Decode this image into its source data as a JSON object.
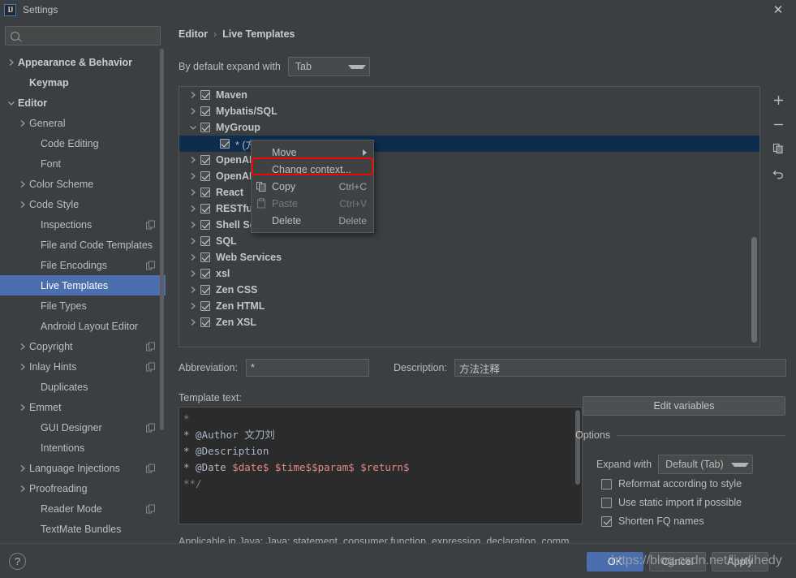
{
  "window": {
    "title": "Settings",
    "logo_text": "IJ",
    "close_label": "✕"
  },
  "sidebar": {
    "search_placeholder": "",
    "search_value": "",
    "items": [
      {
        "label": "Appearance & Behavior",
        "arrow": "right",
        "bold": true,
        "indent": 0,
        "badge": false,
        "selected": false
      },
      {
        "label": "Keymap",
        "arrow": "none",
        "bold": true,
        "indent": 1,
        "badge": false,
        "selected": false
      },
      {
        "label": "Editor",
        "arrow": "down",
        "bold": true,
        "indent": 0,
        "badge": false,
        "selected": false
      },
      {
        "label": "General",
        "arrow": "right",
        "bold": false,
        "indent": 1,
        "badge": false,
        "selected": false
      },
      {
        "label": "Code Editing",
        "arrow": "none",
        "bold": false,
        "indent": 2,
        "badge": false,
        "selected": false
      },
      {
        "label": "Font",
        "arrow": "none",
        "bold": false,
        "indent": 2,
        "badge": false,
        "selected": false
      },
      {
        "label": "Color Scheme",
        "arrow": "right",
        "bold": false,
        "indent": 1,
        "badge": false,
        "selected": false
      },
      {
        "label": "Code Style",
        "arrow": "right",
        "bold": false,
        "indent": 1,
        "badge": false,
        "selected": false
      },
      {
        "label": "Inspections",
        "arrow": "none",
        "bold": false,
        "indent": 2,
        "badge": true,
        "selected": false
      },
      {
        "label": "File and Code Templates",
        "arrow": "none",
        "bold": false,
        "indent": 2,
        "badge": false,
        "selected": false
      },
      {
        "label": "File Encodings",
        "arrow": "none",
        "bold": false,
        "indent": 2,
        "badge": true,
        "selected": false
      },
      {
        "label": "Live Templates",
        "arrow": "none",
        "bold": false,
        "indent": 2,
        "badge": false,
        "selected": true
      },
      {
        "label": "File Types",
        "arrow": "none",
        "bold": false,
        "indent": 2,
        "badge": false,
        "selected": false
      },
      {
        "label": "Android Layout Editor",
        "arrow": "none",
        "bold": false,
        "indent": 2,
        "badge": false,
        "selected": false
      },
      {
        "label": "Copyright",
        "arrow": "right",
        "bold": false,
        "indent": 1,
        "badge": true,
        "selected": false
      },
      {
        "label": "Inlay Hints",
        "arrow": "right",
        "bold": false,
        "indent": 1,
        "badge": true,
        "selected": false
      },
      {
        "label": "Duplicates",
        "arrow": "none",
        "bold": false,
        "indent": 2,
        "badge": false,
        "selected": false
      },
      {
        "label": "Emmet",
        "arrow": "right",
        "bold": false,
        "indent": 1,
        "badge": false,
        "selected": false
      },
      {
        "label": "GUI Designer",
        "arrow": "none",
        "bold": false,
        "indent": 2,
        "badge": true,
        "selected": false
      },
      {
        "label": "Intentions",
        "arrow": "none",
        "bold": false,
        "indent": 2,
        "badge": false,
        "selected": false
      },
      {
        "label": "Language Injections",
        "arrow": "right",
        "bold": false,
        "indent": 1,
        "badge": true,
        "selected": false
      },
      {
        "label": "Proofreading",
        "arrow": "right",
        "bold": false,
        "indent": 1,
        "badge": false,
        "selected": false
      },
      {
        "label": "Reader Mode",
        "arrow": "none",
        "bold": false,
        "indent": 2,
        "badge": true,
        "selected": false
      },
      {
        "label": "TextMate Bundles",
        "arrow": "none",
        "bold": false,
        "indent": 2,
        "badge": false,
        "selected": false
      }
    ]
  },
  "main": {
    "breadcrumb": {
      "parent": "Editor",
      "separator": "›",
      "current": "Live Templates"
    },
    "expand_with": {
      "label": "By default expand with",
      "value": "Tab"
    },
    "tree": [
      {
        "label": "Maven",
        "arrow": "right",
        "checked": true,
        "child": false,
        "selected": false
      },
      {
        "label": "Mybatis/SQL",
        "arrow": "right",
        "checked": true,
        "child": false,
        "selected": false
      },
      {
        "label": "MyGroup",
        "arrow": "down",
        "checked": true,
        "child": false,
        "selected": false
      },
      {
        "label": "* (方法注释)",
        "arrow": "none",
        "checked": true,
        "child": true,
        "selected": true
      },
      {
        "label": "OpenAPI",
        "arrow": "right",
        "checked": true,
        "child": false,
        "selected": false
      },
      {
        "label": "OpenAPI",
        "arrow": "right",
        "checked": true,
        "child": false,
        "selected": false
      },
      {
        "label": "React",
        "arrow": "right",
        "checked": true,
        "child": false,
        "selected": false
      },
      {
        "label": "RESTful",
        "arrow": "right",
        "checked": true,
        "child": false,
        "selected": false
      },
      {
        "label": "Shell Script",
        "arrow": "right",
        "checked": true,
        "child": false,
        "selected": false
      },
      {
        "label": "SQL",
        "arrow": "right",
        "checked": true,
        "child": false,
        "selected": false
      },
      {
        "label": "Web Services",
        "arrow": "right",
        "checked": true,
        "child": false,
        "selected": false
      },
      {
        "label": "xsl",
        "arrow": "right",
        "checked": true,
        "child": false,
        "selected": false
      },
      {
        "label": "Zen CSS",
        "arrow": "right",
        "checked": true,
        "child": false,
        "selected": false
      },
      {
        "label": "Zen HTML",
        "arrow": "right",
        "checked": true,
        "child": false,
        "selected": false
      },
      {
        "label": "Zen XSL",
        "arrow": "right",
        "checked": true,
        "child": false,
        "selected": false
      }
    ],
    "toolbar": {
      "add": "+",
      "remove": "−",
      "duplicate": "duplicate-icon",
      "revert": "revert-icon"
    },
    "context_menu": [
      {
        "label": "Move",
        "accel": "",
        "icon": "",
        "disabled": false,
        "submenu": true,
        "mnemonic": "",
        "highlighted": false
      },
      {
        "label": "Change context...",
        "accel": "",
        "icon": "",
        "disabled": false,
        "submenu": false,
        "mnemonic": "",
        "highlighted": true
      },
      {
        "label": "Copy",
        "accel": "Ctrl+C",
        "icon": "copy-icon",
        "disabled": false,
        "submenu": false,
        "mnemonic": "C",
        "highlighted": false
      },
      {
        "label": "Paste",
        "accel": "Ctrl+V",
        "icon": "paste-icon",
        "disabled": true,
        "submenu": false,
        "mnemonic": "P",
        "highlighted": false
      },
      {
        "label": "Delete",
        "accel": "Delete",
        "icon": "",
        "disabled": false,
        "submenu": false,
        "mnemonic": "D",
        "highlighted": false
      }
    ],
    "abbreviation": {
      "label": "Abbreviation:",
      "value": "*"
    },
    "description": {
      "label": "Description:",
      "value": "方法注释"
    },
    "template_text_label": "Template text:",
    "template_text_lines": [
      "*",
      " * @Author 文刀刘",
      " * @Description",
      " * @Date $date$ $time$$param$ $return$",
      "**/"
    ],
    "applicable_text": "Applicable in Java; Java: statement, consumer function, expression, declaration, comm",
    "edit_variables_label": "Edit variables",
    "options": {
      "title": "Options",
      "expand_with_label": "Expand with",
      "expand_with_value": "Default (Tab)",
      "checkboxes": [
        {
          "label": "Reformat according to style",
          "checked": false
        },
        {
          "label": "Use static import if possible",
          "checked": false
        },
        {
          "label": "Shorten FQ names",
          "checked": true
        }
      ]
    }
  },
  "footer": {
    "help_label": "?",
    "ok_label": "OK",
    "cancel_label": "Cancel",
    "apply_label": "Apply"
  },
  "watermark": "https://blog.csdn.net/liudihedy",
  "colors": {
    "accent": "#4b6eaf",
    "highlight_box": "#ff0000",
    "selection_tree": "#0d2d4e",
    "background": "#3c3f41",
    "editor_bg": "#2b2b2b",
    "variable": "#e08a8a"
  }
}
